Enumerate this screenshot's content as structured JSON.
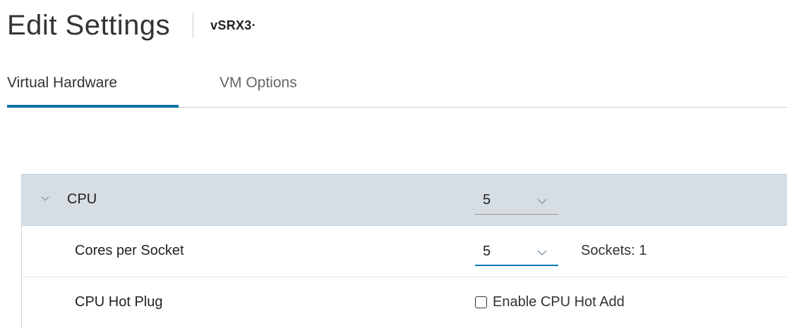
{
  "header": {
    "title": "Edit Settings",
    "vm_name": "vSRX3·"
  },
  "tabs": [
    {
      "label": "Virtual Hardware",
      "active": true
    },
    {
      "label": "VM Options",
      "active": false
    }
  ],
  "settings": {
    "cpu": {
      "label": "CPU",
      "value": "5",
      "expanded": true
    },
    "cores_per_socket": {
      "label": "Cores per Socket",
      "value": "5",
      "sockets_text": "Sockets: 1"
    },
    "cpu_hot_plug": {
      "label": "CPU Hot Plug",
      "checkbox_label": "Enable CPU Hot Add",
      "checked": false
    }
  },
  "colors": {
    "accent": "#0072a3",
    "cpu_row_bg": "#d6dee4",
    "focus_underline": "#0079b8"
  }
}
